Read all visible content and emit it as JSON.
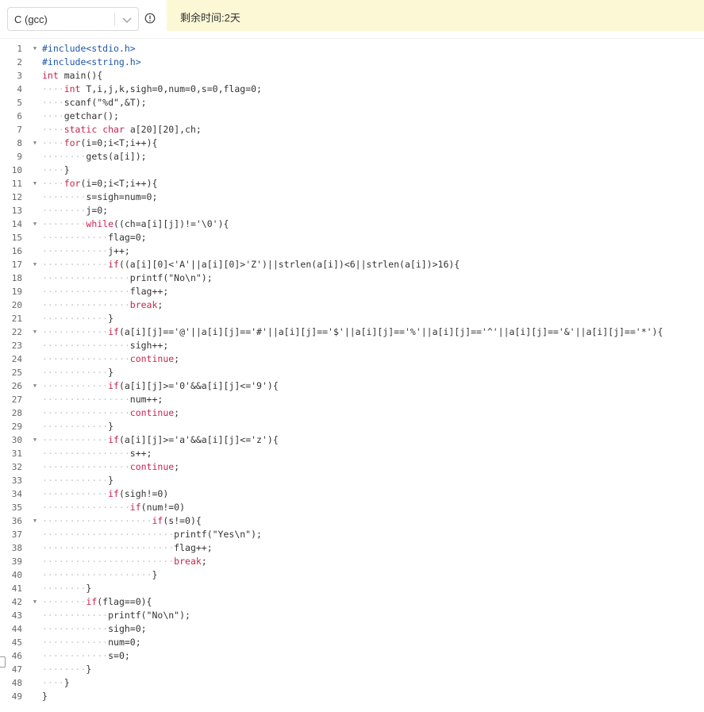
{
  "toolbar": {
    "language": "C (gcc)",
    "timer": "剩余时间:2天"
  },
  "icons": {
    "dropdown": "chevron-down-icon",
    "info": "info-icon",
    "side": "panel-toggle-icon"
  },
  "colors": {
    "banner": "#fcf8d6",
    "keyword": "#c7254e",
    "preprocessor": "#1f57a8"
  },
  "code": {
    "lines": [
      "#include<stdio.h>",
      "#include<string.h>",
      "int main(){",
      "····int T,i,j,k,sigh=0,num=0,s=0,flag=0;",
      "····scanf(\"%d\",&T);",
      "····getchar();",
      "····static char a[20][20],ch;",
      "····for(i=0;i<T;i++){",
      "········gets(a[i]);",
      "····}",
      "····for(i=0;i<T;i++){",
      "········s=sigh=num=0;",
      "········j=0;",
      "········while((ch=a[i][j])!='\\0'){",
      "············flag=0;",
      "············j++;",
      "············if((a[i][0]<'A'||a[i][0]>'Z')||strlen(a[i])<6||strlen(a[i])>16){",
      "················printf(\"No\\n\");",
      "················flag++;",
      "················break;",
      "············}",
      "············if(a[i][j]=='@'||a[i][j]=='#'||a[i][j]=='$'||a[i][j]=='%'||a[i][j]=='^'||a[i][j]=='&'||a[i][j]=='*'){",
      "················sigh++;",
      "················continue;",
      "············}",
      "············if(a[i][j]>='0'&&a[i][j]<='9'){",
      "················num++;",
      "················continue;",
      "············}",
      "············if(a[i][j]>='a'&&a[i][j]<='z'){",
      "················s++;",
      "················continue;",
      "············}",
      "············if(sigh!=0)",
      "················if(num!=0)",
      "····················if(s!=0){",
      "························printf(\"Yes\\n\");",
      "························flag++;",
      "························break;",
      "····················}",
      "········}",
      "········if(flag==0){",
      "············printf(\"No\\n\");",
      "············sigh=0;",
      "············num=0;",
      "············s=0;",
      "········}",
      "····}",
      "}"
    ],
    "folds": [
      1,
      8,
      11,
      14,
      17,
      22,
      26,
      30,
      36,
      42
    ],
    "keywords": [
      "int",
      "static",
      "char",
      "for",
      "while",
      "if",
      "break",
      "continue"
    ]
  }
}
